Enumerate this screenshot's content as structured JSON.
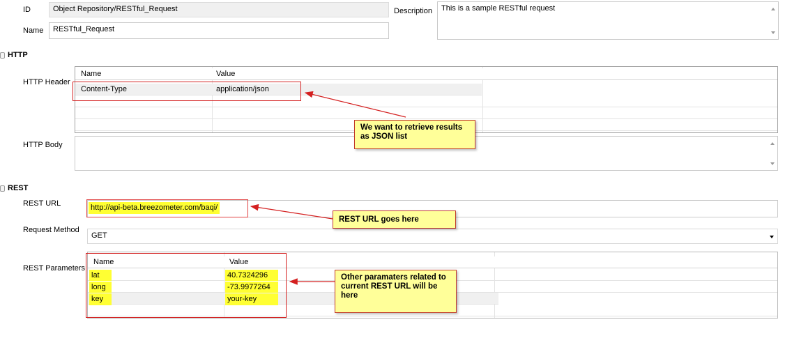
{
  "general": {
    "id_label": "ID",
    "id_value": "Object Repository/RESTful_Request",
    "name_label": "Name",
    "name_value": "RESTful_Request",
    "description_label": "Description",
    "description_value": "This is a sample RESTful request"
  },
  "http": {
    "section_title": "HTTP",
    "header_label": "HTTP Header",
    "columns": [
      "Name",
      "Value"
    ],
    "rows": [
      {
        "name": "Content-Type",
        "value": "application/json"
      }
    ],
    "body_label": "HTTP Body",
    "body_value": ""
  },
  "rest": {
    "section_title": "REST",
    "url_label": "REST URL",
    "url_value": "http://api-beta.breezometer.com/baqi/",
    "method_label": "Request Method",
    "method_value": "GET",
    "params_label": "REST Parameters",
    "columns": [
      "Name",
      "Value"
    ],
    "rows": [
      {
        "name": "lat",
        "value": "40.7324296"
      },
      {
        "name": "long",
        "value": "-73.9977264"
      },
      {
        "name": "key",
        "value": "your-key"
      }
    ]
  },
  "annotations": {
    "json_note": "We want to retrieve results as JSON list",
    "url_note": "REST URL goes here",
    "params_note": "Other paramaters related to current REST URL will be here"
  },
  "colors": {
    "highlight": "#ffff33",
    "callout_border": "#d42020",
    "note_bg": "#ffff99"
  }
}
